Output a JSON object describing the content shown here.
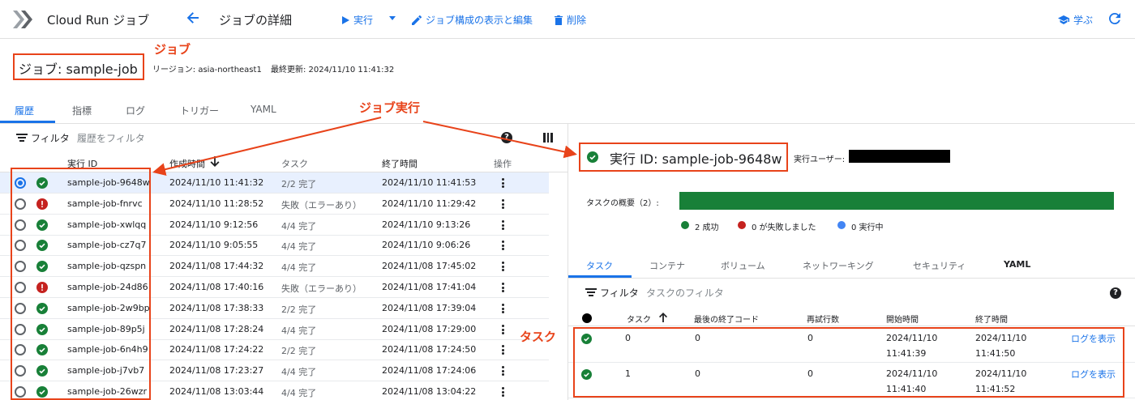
{
  "header": {
    "app_title": "Cloud Run ジョブ",
    "page_title": "ジョブの詳細",
    "run_label": "実行",
    "edit_label": "ジョブ構成の表示と編集",
    "delete_label": "削除",
    "learn_label": "学ぶ"
  },
  "job": {
    "name": "ジョブ: sample-job",
    "region": "リージョン: asia-northeast1",
    "updated": "最終更新: 2024/11/10 11:41:32"
  },
  "annotations": {
    "job": "ジョブ",
    "execution": "ジョブ実行",
    "task": "タスク"
  },
  "tabs": [
    {
      "label": "履歴",
      "active": true
    },
    {
      "label": "指標",
      "active": false
    },
    {
      "label": "ログ",
      "active": false
    },
    {
      "label": "トリガー",
      "active": false
    },
    {
      "label": "YAML",
      "active": false
    }
  ],
  "left_filter": {
    "label": "フィルタ",
    "placeholder": "履歴をフィルタ"
  },
  "left_table": {
    "headers": [
      "実行 ID",
      "作成時間",
      "タスク",
      "終了時間",
      "操作"
    ],
    "rows": [
      {
        "id": "sample-job-9648w",
        "created": "2024/11/10 11:41:32",
        "tasks": "2/2 完了",
        "ended": "2024/11/10 11:41:53",
        "status": "ok",
        "selected": true
      },
      {
        "id": "sample-job-fnrvc",
        "created": "2024/11/10 11:28:52",
        "tasks": "失敗（エラーあり）",
        "ended": "2024/11/10 11:29:42",
        "status": "err",
        "selected": false
      },
      {
        "id": "sample-job-xwlqq",
        "created": "2024/11/10 9:12:56",
        "tasks": "4/4 完了",
        "ended": "2024/11/10 9:13:26",
        "status": "ok",
        "selected": false
      },
      {
        "id": "sample-job-cz7q7",
        "created": "2024/11/10 9:05:55",
        "tasks": "4/4 完了",
        "ended": "2024/11/10 9:06:26",
        "status": "ok",
        "selected": false
      },
      {
        "id": "sample-job-qzspn",
        "created": "2024/11/08 17:44:32",
        "tasks": "4/4 完了",
        "ended": "2024/11/08 17:45:02",
        "status": "ok",
        "selected": false
      },
      {
        "id": "sample-job-24d86",
        "created": "2024/11/08 17:40:16",
        "tasks": "失敗（エラーあり）",
        "ended": "2024/11/08 17:41:04",
        "status": "err",
        "selected": false
      },
      {
        "id": "sample-job-2w9bp",
        "created": "2024/11/08 17:38:33",
        "tasks": "2/2 完了",
        "ended": "2024/11/08 17:39:04",
        "status": "ok",
        "selected": false
      },
      {
        "id": "sample-job-89p5j",
        "created": "2024/11/08 17:28:24",
        "tasks": "4/4 完了",
        "ended": "2024/11/08 17:29:00",
        "status": "ok",
        "selected": false
      },
      {
        "id": "sample-job-6n4h9",
        "created": "2024/11/08 17:24:22",
        "tasks": "2/2 完了",
        "ended": "2024/11/08 17:24:50",
        "status": "ok",
        "selected": false
      },
      {
        "id": "sample-job-j7vb7",
        "created": "2024/11/08 17:23:27",
        "tasks": "4/4 完了",
        "ended": "2024/11/08 17:24:06",
        "status": "ok",
        "selected": false
      },
      {
        "id": "sample-job-26wzr",
        "created": "2024/11/08 13:03:44",
        "tasks": "4/4 完了",
        "ended": "2024/11/08 13:04:22",
        "status": "ok",
        "selected": false
      }
    ]
  },
  "execution": {
    "title": "実行 ID: sample-job-9648w",
    "user_label": "実行ユーザー:",
    "summary_label": "タスクの概要（2）:",
    "success_fraction": 1.0,
    "legend": [
      {
        "label": "2 成功",
        "color": "#188038"
      },
      {
        "label": "0 が失敗しました",
        "color": "#c5221f"
      },
      {
        "label": "0 実行中",
        "color": "#4285f4"
      }
    ]
  },
  "right_tabs": [
    {
      "label": "タスク",
      "active": true
    },
    {
      "label": "コンテナ",
      "active": false
    },
    {
      "label": "ボリューム",
      "active": false
    },
    {
      "label": "ネットワーキング",
      "active": false
    },
    {
      "label": "セキュリティ",
      "active": false
    },
    {
      "label": "YAML",
      "active": false
    }
  ],
  "right_filter": {
    "label": "フィルタ",
    "placeholder": "タスクのフィルタ"
  },
  "task_table": {
    "headers": [
      "タスク",
      "最後の終了コード",
      "再試行数",
      "開始時間",
      "終了時間"
    ],
    "rows": [
      {
        "task": "0",
        "exit_code": "0",
        "retries": "0",
        "start_date": "2024/11/10",
        "start_time": "11:41:39",
        "end_date": "2024/11/10",
        "end_time": "11:41:50",
        "link": "ログを表示"
      },
      {
        "task": "1",
        "exit_code": "0",
        "retries": "0",
        "start_date": "2024/11/10",
        "start_time": "11:41:40",
        "end_date": "2024/11/10",
        "end_time": "11:41:52",
        "link": "ログを表示"
      }
    ]
  },
  "colors": {
    "accent": "#1a73e8",
    "success": "#188038",
    "error": "#c5221f",
    "annotation": "#e8431a"
  }
}
